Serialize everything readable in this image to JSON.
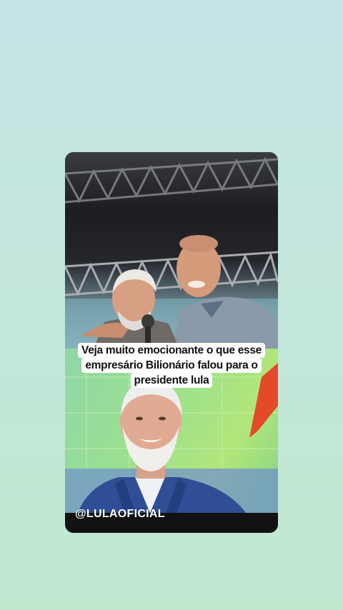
{
  "post": {
    "caption_lines": [
      "Veja muito emocionante o que  esse",
      "empresário Bilionário  falou  para o",
      "presidente lula"
    ],
    "handle": "@LULAOFICIAL"
  },
  "colors": {
    "background_top": "#c6e4e6",
    "background_bottom": "#c0e8cf",
    "caption_bg": "#ffffff",
    "caption_text": "#111111",
    "suit_blue": "#2f4e96",
    "backdrop_green": "#9be08f"
  },
  "icons": [
    "microphone-icon"
  ]
}
